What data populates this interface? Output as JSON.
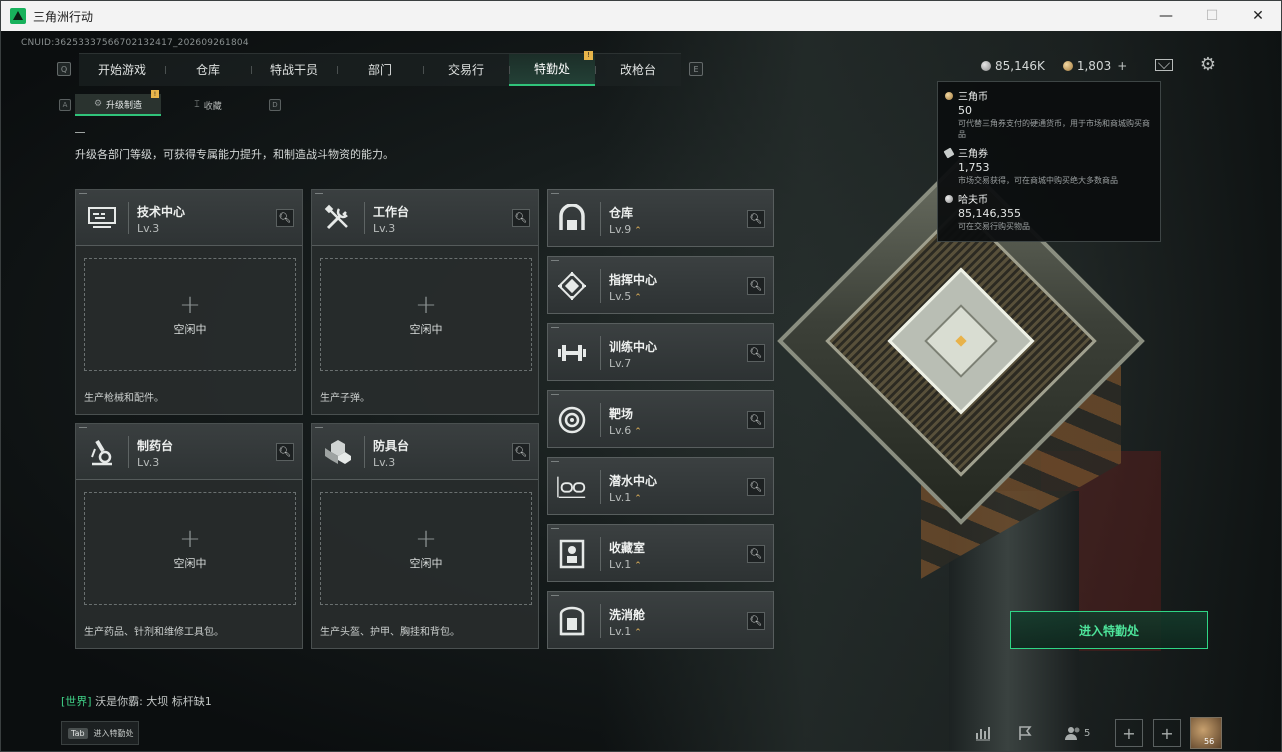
{
  "window": {
    "title": "三角洲行动",
    "minimize": "—",
    "maximize": "☐",
    "close": "✕"
  },
  "uid": "CNUID:3625333756670213241​7_202609261804",
  "nav": {
    "left_key": "Q",
    "right_key": "E",
    "tabs": [
      {
        "label": "开始游戏"
      },
      {
        "label": "仓库"
      },
      {
        "label": "特战干员"
      },
      {
        "label": "部门"
      },
      {
        "label": "交易行"
      },
      {
        "label": "特勤处",
        "active": true,
        "badge": "!"
      },
      {
        "label": "改枪台"
      }
    ]
  },
  "subnav": {
    "left_key": "A",
    "right_key": "D",
    "tabs": [
      {
        "label": "升级制造",
        "icon": "⚙",
        "active": true,
        "badge": "!"
      },
      {
        "label": "收藏",
        "icon": "⌶"
      }
    ]
  },
  "description": "升级各部门等级，可获得专属能力提升，和制造战斗物资的能力。",
  "currency": {
    "silver": "85,146K",
    "gold": "1,803",
    "plus": "+"
  },
  "tooltip": [
    {
      "name": "三角币",
      "value": "50",
      "note": "可代替三角券支付的硬通货币，用于市场和商城购买商品"
    },
    {
      "name": "三角券",
      "value": "1,753",
      "note": "市场交易获得，可在商城中购买绝大多数商品"
    },
    {
      "name": "哈夫币",
      "value": "85,146,355",
      "note": "可在交易行购买物品"
    }
  ],
  "production_cards": [
    {
      "name": "技术中心",
      "level": "Lv.3",
      "status": "空闲中",
      "note": "生产枪械和配件。",
      "icon": "computer-icon"
    },
    {
      "name": "工作台",
      "level": "Lv.3",
      "status": "空闲中",
      "note": "生产子弹。",
      "icon": "tools-icon"
    },
    {
      "name": "制药台",
      "level": "Lv.3",
      "status": "空闲中",
      "note": "生产药品、针剂和维修工具包。",
      "icon": "microscope-icon"
    },
    {
      "name": "防具台",
      "level": "Lv.3",
      "status": "空闲中",
      "note": "生产头盔、护甲、胸挂和背包。",
      "icon": "blocks-icon"
    }
  ],
  "department_cards": [
    {
      "name": "仓库",
      "level": "Lv.9",
      "upgrade": "⌃",
      "icon": "warehouse-icon"
    },
    {
      "name": "指挥中心",
      "level": "Lv.5",
      "upgrade": "⌃",
      "icon": "command-icon"
    },
    {
      "name": "训练中心",
      "level": "Lv.7",
      "upgrade": "",
      "icon": "dumbbell-icon"
    },
    {
      "name": "靶场",
      "level": "Lv.6",
      "upgrade": "⌃",
      "icon": "target-icon"
    },
    {
      "name": "潜水中心",
      "level": "Lv.1",
      "upgrade": "⌃",
      "icon": "goggles-icon"
    },
    {
      "name": "收藏室",
      "level": "Lv.1",
      "upgrade": "⌃",
      "icon": "collection-icon"
    },
    {
      "name": "洗消舱",
      "level": "Lv.1",
      "upgrade": "⌃",
      "icon": "decon-icon"
    }
  ],
  "enter_button": "进入特勤处",
  "chat": {
    "channel": "[世界]",
    "text": " 沃是你霸: 大坝 标杆缺1"
  },
  "tab_hint": {
    "key": "Tab",
    "label": "进入特勤处"
  },
  "friends_count": "5",
  "avatar_level": "56"
}
